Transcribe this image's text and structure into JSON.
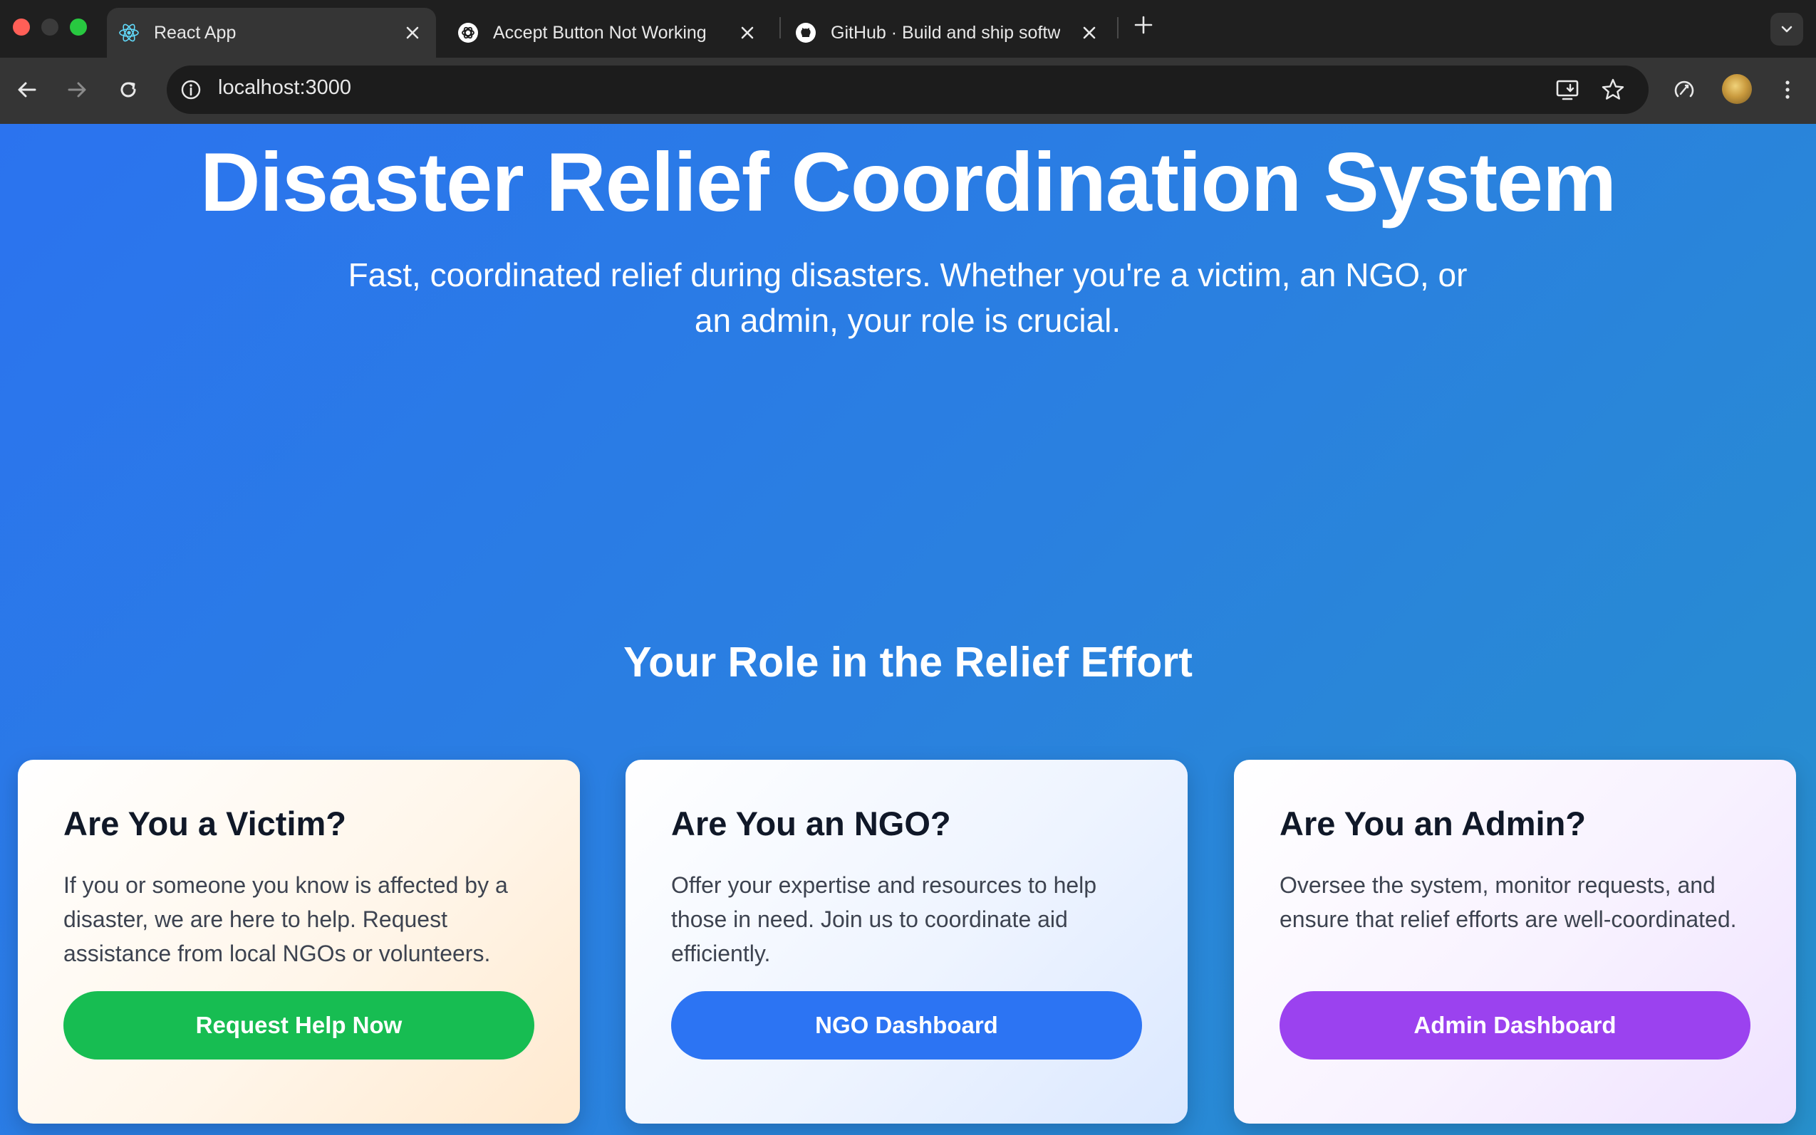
{
  "browser": {
    "tabs": [
      {
        "title": "React App",
        "icon": "react-icon",
        "active": true
      },
      {
        "title": "Accept Button Not Working",
        "icon": "chatgpt-icon",
        "active": false
      },
      {
        "title": "GitHub · Build and ship softw",
        "icon": "github-icon",
        "active": false
      }
    ],
    "url": "localhost:3000"
  },
  "hero": {
    "title": "Disaster Relief Coordination System",
    "subtitle": "Fast, coordinated relief during disasters. Whether you're a victim, an NGO, or an admin, your role is crucial."
  },
  "roles": {
    "heading": "Your Role in the Relief Effort",
    "cards": [
      {
        "title": "Are You a Victim?",
        "text": "If you or someone you know is affected by a disaster, we are here to help. Request assistance from local NGOs or volunteers.",
        "button": "Request Help Now"
      },
      {
        "title": "Are You an NGO?",
        "text": "Offer your expertise and resources to help those in need. Join us to coordinate aid efficiently.",
        "button": "NGO Dashboard"
      },
      {
        "title": "Are You an Admin?",
        "text": "Oversee the system, monitor requests, and ensure that relief efforts are well-coordinated.",
        "button": "Admin Dashboard"
      }
    ]
  },
  "colors": {
    "page_gradient_start": "#2b73ef",
    "page_gradient_end": "#2790cc",
    "victim_button": "#17bd52",
    "ngo_button": "#2c74f3",
    "admin_button": "#9b42ef"
  }
}
